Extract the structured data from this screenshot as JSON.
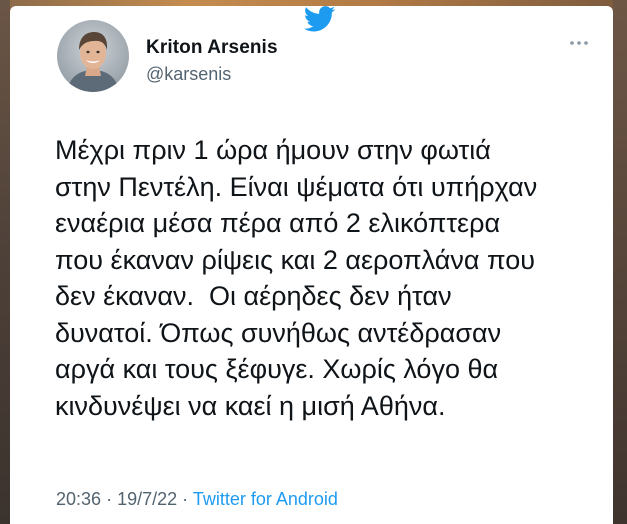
{
  "tweet": {
    "author": {
      "name": "Kriton Arsenis",
      "handle": "@karsenis"
    },
    "text": "Μέχρι πριν 1 ώρα ήμουν στην φωτιά\nστην Πεντέλη. Είναι ψέματα ότι υπήρχαν\nεναέρια μέσα πέρα από 2 ελικόπτερα\nπου έκαναν ρίψεις και 2 αεροπλάνα που\nδεν έκαναν.  Οι αέρηδες δεν ήταν\nδυνατοί. Όπως συνήθως αντέδρασαν\nαργά και τους ξέφυγε. Χωρίς λόγο θα\nκινδυνέψει να καεί η μισή Αθήνα.",
    "time": "20:36",
    "date": "19/7/22",
    "separator": "·",
    "source": "Twitter for Android"
  },
  "icons": {
    "brand": "twitter-bird-icon",
    "menu": "more-options-icon"
  },
  "colors": {
    "brand_blue": "#1d9bf0",
    "text_primary": "#0f1419",
    "text_secondary": "#536471"
  }
}
